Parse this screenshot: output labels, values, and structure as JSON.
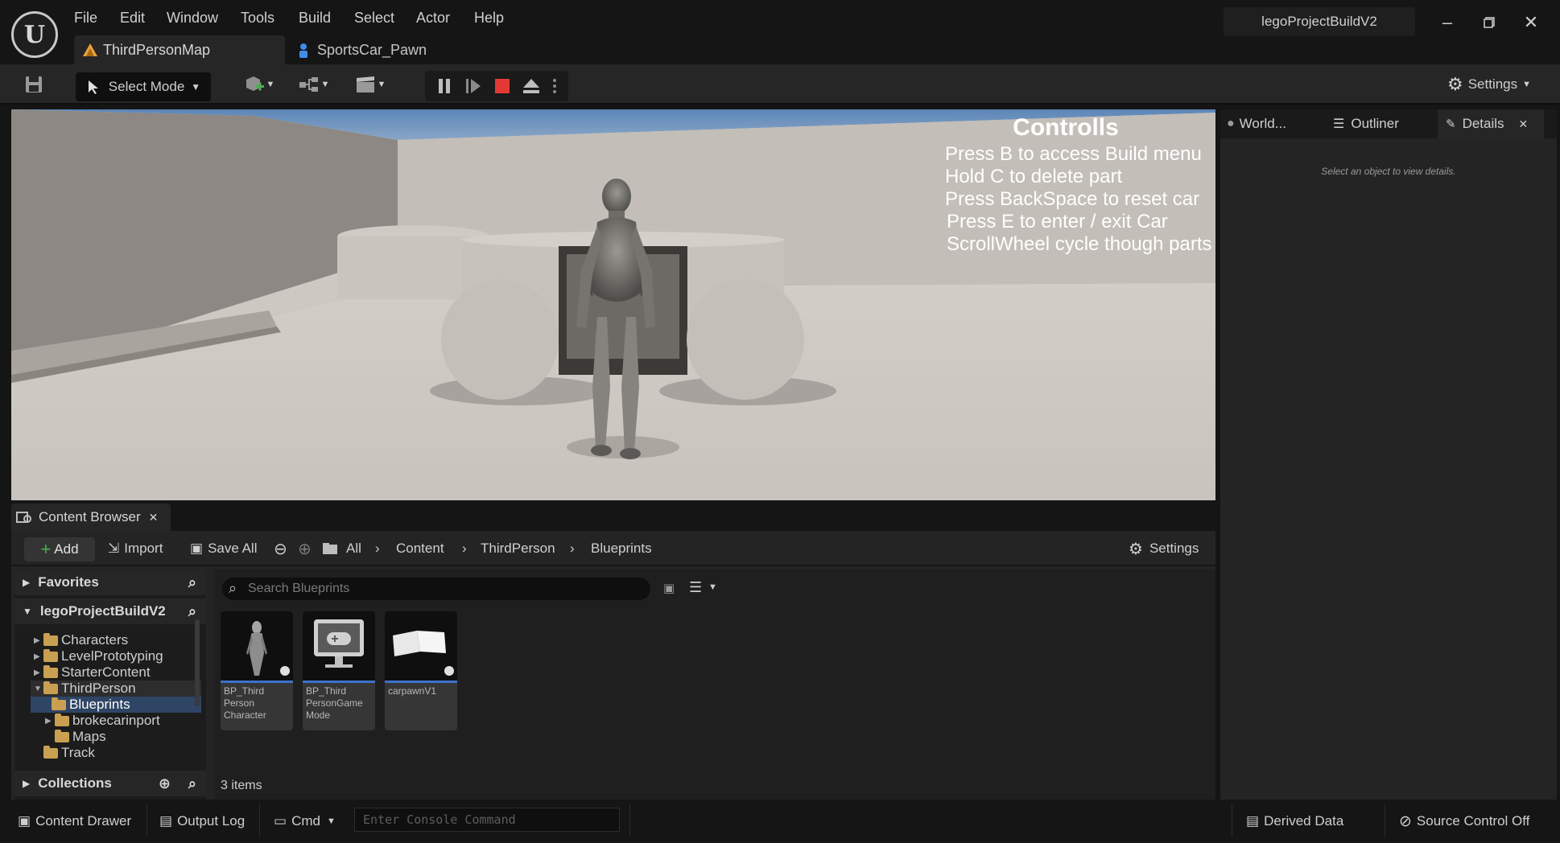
{
  "menu": [
    "File",
    "Edit",
    "Window",
    "Tools",
    "Build",
    "Select",
    "Actor",
    "Help"
  ],
  "tabs": {
    "map": "ThirdPersonMap",
    "pawn": "SportsCar_Pawn"
  },
  "project_name": "legoProjectBuildV2",
  "toolbar": {
    "select_mode": "Select Mode",
    "settings": "Settings"
  },
  "viewport": {
    "controls_title": "Controlls",
    "controls_lines": [
      "Press B to access Build menu",
      "Hold C to delete part",
      "Press BackSpace to reset car",
      "Press E to enter / exit Car",
      "ScrollWheel cycle though parts"
    ]
  },
  "right_panel": {
    "tabs": [
      "World...",
      "Outliner",
      "Details"
    ],
    "empty_text": "Select an object to view details."
  },
  "content_browser": {
    "tab_label": "Content Browser",
    "add_label": "Add",
    "import_label": "Import",
    "save_all_label": "Save All",
    "breadcrumb": [
      "All",
      "Content",
      "ThirdPerson",
      "Blueprints"
    ],
    "settings_label": "Settings",
    "favorites_label": "Favorites",
    "project_label": "legoProjectBuildV2",
    "collections_label": "Collections",
    "tree": [
      "Characters",
      "LevelPrototyping",
      "StarterContent",
      "ThirdPerson",
      "Blueprints",
      "brokecarinport",
      "Maps",
      "Track"
    ],
    "search_placeholder": "Search Blueprints",
    "assets": [
      {
        "name": "BP_Third Person Character"
      },
      {
        "name": "BP_Third PersonGame Mode"
      },
      {
        "name": "carpawnV1"
      }
    ],
    "item_count": "3 items"
  },
  "statusbar": {
    "content_drawer": "Content Drawer",
    "output_log": "Output Log",
    "cmd": "Cmd",
    "console_placeholder": "Enter Console Command",
    "derived_data": "Derived Data",
    "source_control": "Source Control Off"
  },
  "colors": {
    "accent_blue": "#3c73c8",
    "stop_red": "#e53935",
    "folder": "#c9a052"
  }
}
